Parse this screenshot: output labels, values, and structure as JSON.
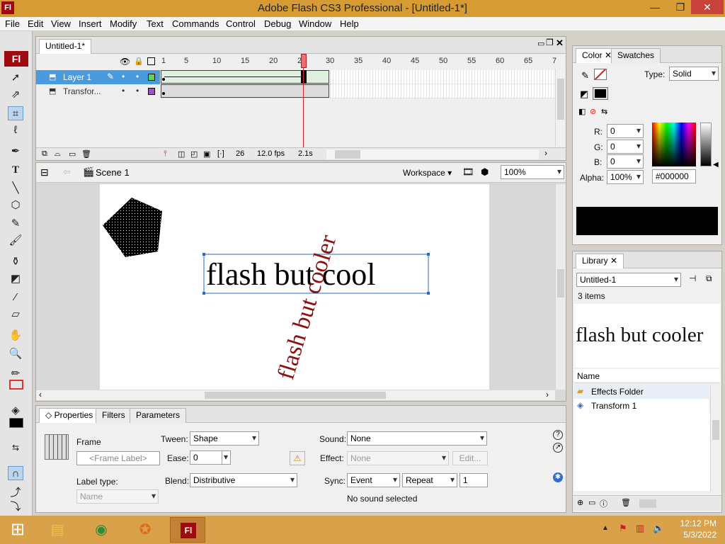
{
  "window": {
    "title": "Adobe Flash CS3 Professional - [Untitled-1*]",
    "app_icon": "Fl",
    "minimize": "—",
    "restore": "❐",
    "close": "✕"
  },
  "menu": [
    "File",
    "Edit",
    "View",
    "Insert",
    "Modify",
    "Text",
    "Commands",
    "Control",
    "Debug",
    "Window",
    "Help"
  ],
  "tools": {
    "logo": "Fl"
  },
  "timeline": {
    "doc_tab": "Untitled-1*",
    "ruler": [
      "1",
      "5",
      "10",
      "15",
      "20",
      "25",
      "30",
      "35",
      "40",
      "45",
      "50",
      "55",
      "60",
      "65",
      "7"
    ],
    "layers": [
      {
        "name": "Layer 1",
        "color": "#5ad55a",
        "selected": true
      },
      {
        "name": "Transfor...",
        "color": "#a04fc9",
        "selected": false
      }
    ],
    "status": {
      "frame": "26",
      "fps": "12.0 fps",
      "time": "2.1s"
    },
    "playhead_frame": 26
  },
  "stagebar": {
    "scene": "Scene 1",
    "workspace": "Workspace ▾",
    "zoom": "100%"
  },
  "stage": {
    "text_main": "flash but cool",
    "text_rotated": "flash but cooler"
  },
  "properties": {
    "tabs": [
      "Properties",
      "Filters",
      "Parameters"
    ],
    "frame_label": "Frame",
    "frame_placeholder": "<Frame Label>",
    "label_type_label": "Label type:",
    "label_type_value": "Name",
    "tween_label": "Tween:",
    "tween_value": "Shape",
    "ease_label": "Ease:",
    "ease_value": "0",
    "blend_label": "Blend:",
    "blend_value": "Distributive",
    "sound_label": "Sound:",
    "sound_value": "None",
    "effect_label": "Effect:",
    "effect_value": "None",
    "edit_button": "Edit...",
    "sync_label": "Sync:",
    "sync_value": "Event",
    "repeat_value": "Repeat",
    "repeat_count": "1",
    "no_sound": "No sound selected"
  },
  "color": {
    "tabs": [
      "Color",
      "Swatches"
    ],
    "type_label": "Type:",
    "type_value": "Solid",
    "r_label": "R:",
    "r_value": "0",
    "g_label": "G:",
    "g_value": "0",
    "b_label": "B:",
    "b_value": "0",
    "alpha_label": "Alpha:",
    "alpha_value": "100%",
    "hex": "#000000",
    "fill": "#000000"
  },
  "library": {
    "tab": "Library",
    "doc": "Untitled-1",
    "count": "3 items",
    "preview_text": "flash but cooler",
    "column": "Name",
    "items": [
      {
        "name": "Effects Folder",
        "icon": "folder-icon"
      },
      {
        "name": "Transform 1",
        "icon": "graphic-symbol-icon"
      }
    ]
  },
  "taskbar": {
    "time": "12:12 PM",
    "date": "5/3/2022"
  }
}
